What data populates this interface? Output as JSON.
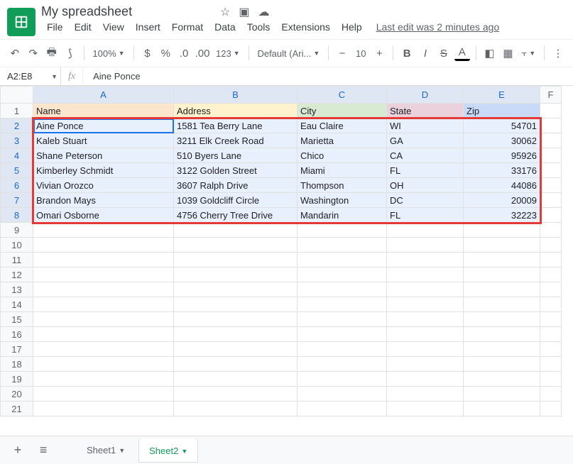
{
  "doc": {
    "title": "My spreadsheet",
    "last_edit": "Last edit was 2 minutes ago"
  },
  "menu": [
    "File",
    "Edit",
    "View",
    "Insert",
    "Format",
    "Data",
    "Tools",
    "Extensions",
    "Help"
  ],
  "toolbar": {
    "zoom": "100%",
    "fmt123": "123",
    "font": "Default (Ari...",
    "size": "10"
  },
  "namebox": "A2:E8",
  "formula": "Aine Ponce",
  "columns": [
    "A",
    "B",
    "C",
    "D",
    "E",
    "F"
  ],
  "headers": {
    "A": "Name",
    "B": "Address",
    "C": "City",
    "D": "State",
    "E": "Zip"
  },
  "rows": [
    {
      "A": "Aine Ponce",
      "B": "1581 Tea Berry Lane",
      "C": "Eau Claire",
      "D": "WI",
      "E": "54701"
    },
    {
      "A": "Kaleb Stuart",
      "B": "3211 Elk Creek Road",
      "C": "Marietta",
      "D": "GA",
      "E": "30062"
    },
    {
      "A": "Shane Peterson",
      "B": "510 Byers Lane",
      "C": "Chico",
      "D": "CA",
      "E": "95926"
    },
    {
      "A": "Kimberley Schmidt",
      "B": "3122 Golden Street",
      "C": "Miami",
      "D": "FL",
      "E": "33176"
    },
    {
      "A": "Vivian Orozco",
      "B": "3607 Ralph Drive",
      "C": "Thompson",
      "D": "OH",
      "E": "44086"
    },
    {
      "A": "Brandon Mays",
      "B": "1039 Goldcliff Circle",
      "C": "Washington",
      "D": "DC",
      "E": "20009"
    },
    {
      "A": "Omari Osborne",
      "B": "4756 Cherry Tree Drive",
      "C": "Mandarin",
      "D": "FL",
      "E": "32223"
    }
  ],
  "total_rows": 21,
  "tabs": {
    "list": [
      "Sheet1",
      "Sheet2"
    ],
    "active": 1
  }
}
